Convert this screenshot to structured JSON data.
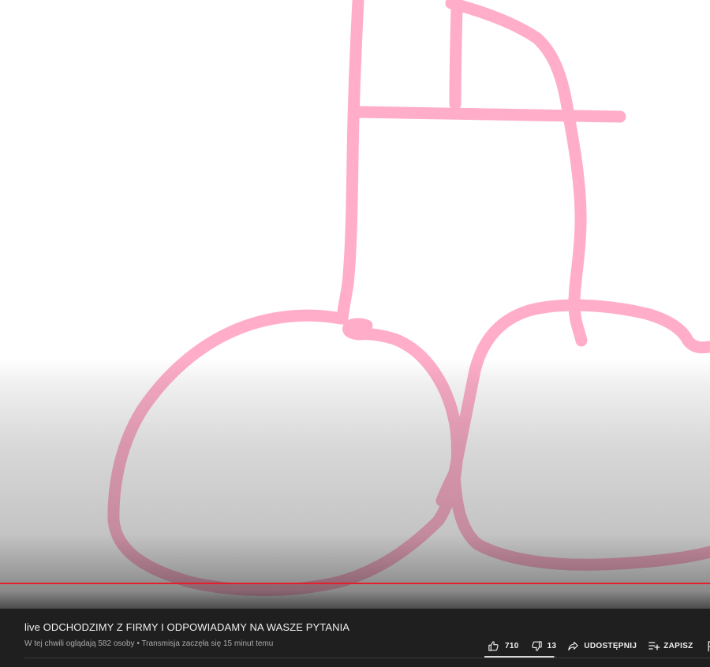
{
  "video": {
    "title": "live ODCHODZIMY Z FIRMY I ODPOWIADAMY NA WASZE PYTANIA",
    "viewers_text": "W tej chwili oglądają 582 osoby",
    "separator": "•",
    "started_text": "Transmisja zaczęła się 15 minut temu",
    "drawing_color": "#ffadc9"
  },
  "actions": {
    "likes": "710",
    "dislikes": "13",
    "share_label": "UDOSTĘPNIJ",
    "save_label": "ZAPISZ",
    "like_ratio": 0.982
  },
  "colors": {
    "background": "#1f1f1f",
    "progress": "#e3202a",
    "text": "#f1f1f1",
    "secondary_text": "#aaaaaa"
  },
  "icons": {
    "like": "thumbs-up-icon",
    "dislike": "thumbs-down-icon",
    "share": "share-arrow-icon",
    "save": "playlist-add-icon",
    "report": "flag-icon"
  }
}
